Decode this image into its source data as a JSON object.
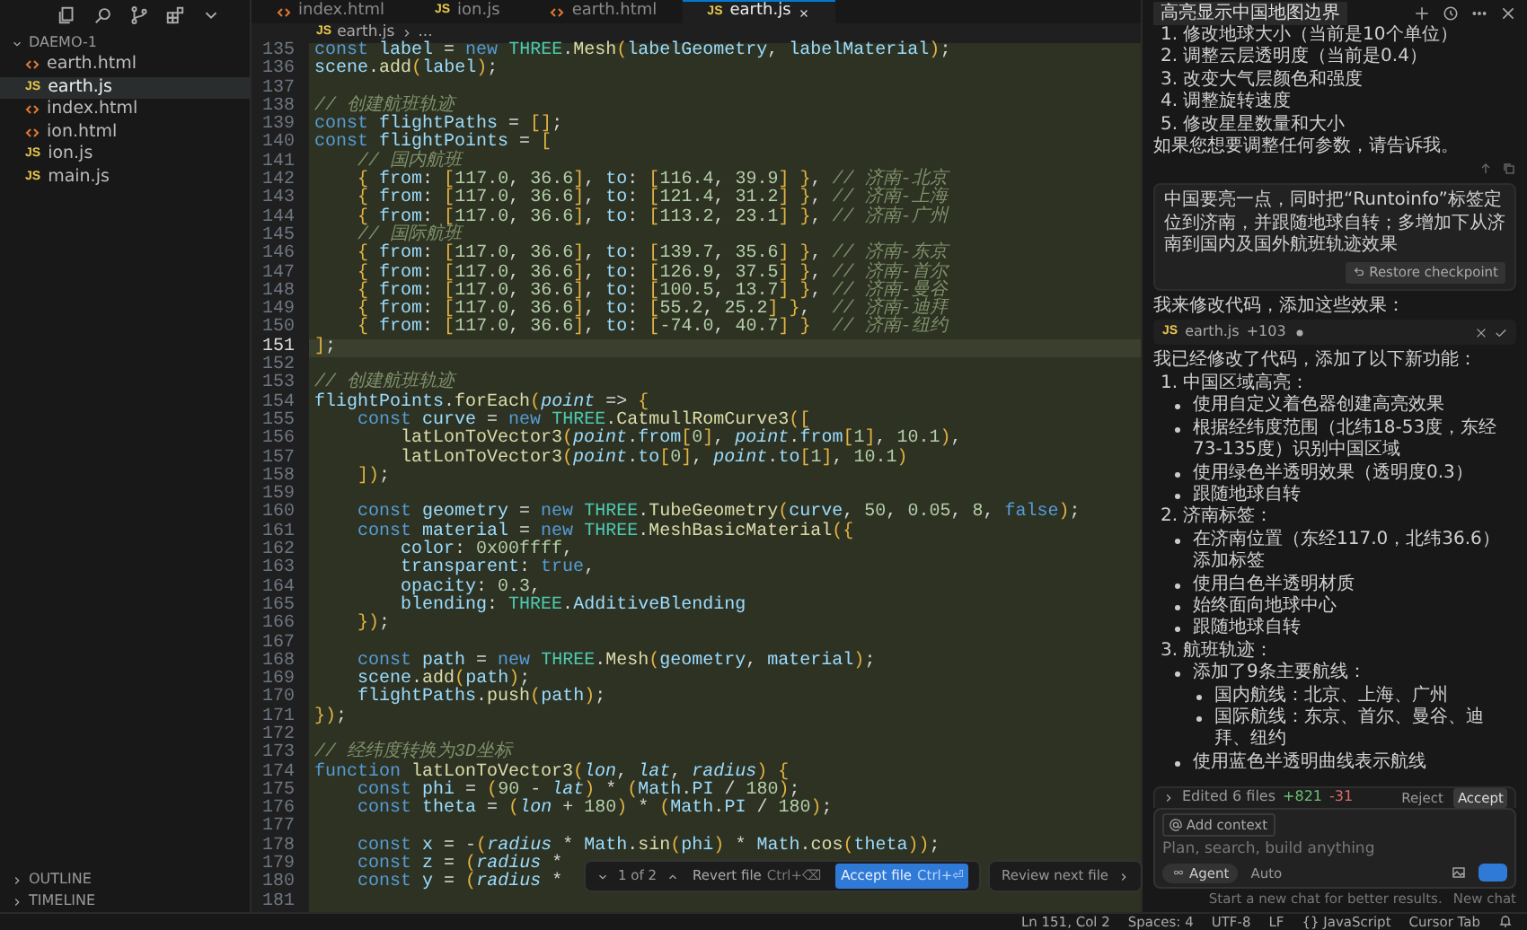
{
  "activity_icons": [
    {
      "kind": "files"
    },
    {
      "kind": "search"
    },
    {
      "kind": "branch"
    },
    {
      "kind": "extensions"
    },
    {
      "kind": "chevron"
    }
  ],
  "explorer": {
    "title": "DAEMO-1",
    "files": [
      {
        "name": "earth.html",
        "kind": "html",
        "selected": false
      },
      {
        "name": "earth.js",
        "kind": "js",
        "badge": "JS",
        "selected": true
      },
      {
        "name": "index.html",
        "kind": "html",
        "selected": false
      },
      {
        "name": "ion.html",
        "kind": "html",
        "selected": false
      },
      {
        "name": "ion.js",
        "kind": "js",
        "badge": "JS",
        "selected": false
      },
      {
        "name": "main.js",
        "kind": "js",
        "badge": "JS",
        "selected": false
      }
    ],
    "sections": [
      "OUTLINE",
      "TIMELINE"
    ]
  },
  "tabs": [
    {
      "label": "index.html",
      "kind": "html",
      "selected": false
    },
    {
      "label": "ion.js",
      "kind": "js",
      "badge": "JS",
      "selected": false
    },
    {
      "label": "earth.html",
      "kind": "html",
      "selected": false
    },
    {
      "label": "earth.js",
      "kind": "js",
      "badge": "JS",
      "selected": true
    }
  ],
  "breadcrumb": {
    "badge": "JS",
    "file": "earth.js",
    "rest": "..."
  },
  "code": [
    {
      "number": "135",
      "current": false,
      "tokens": [
        {
          "kind": "kw",
          "text": "const "
        },
        {
          "kind": "prop",
          "text": "label"
        },
        {
          "kind": "punc",
          "text": " = "
        },
        {
          "kind": "kw",
          "text": "new "
        },
        {
          "kind": "cls",
          "text": "THREE"
        },
        {
          "kind": "punc",
          "text": "."
        },
        {
          "kind": "fn",
          "text": "Mesh"
        },
        {
          "kind": "brk",
          "text": "("
        },
        {
          "kind": "prop",
          "text": "labelGeometry"
        },
        {
          "kind": "punc",
          "text": ", "
        },
        {
          "kind": "prop",
          "text": "labelMaterial"
        },
        {
          "kind": "brk",
          "text": ")"
        },
        {
          "kind": "punc",
          "text": ";"
        }
      ]
    },
    {
      "number": "136",
      "current": false,
      "tokens": [
        {
          "kind": "prop",
          "text": "scene"
        },
        {
          "kind": "punc",
          "text": "."
        },
        {
          "kind": "fn",
          "text": "add"
        },
        {
          "kind": "brk",
          "text": "("
        },
        {
          "kind": "prop",
          "text": "label"
        },
        {
          "kind": "brk",
          "text": ")"
        },
        {
          "kind": "punc",
          "text": ";"
        }
      ]
    },
    {
      "number": "137",
      "current": false
    },
    {
      "number": "138",
      "current": false,
      "tokens": [
        {
          "kind": "cmt",
          "text": "// 创建航班轨迹"
        }
      ]
    },
    {
      "number": "139",
      "current": false,
      "tokens": [
        {
          "kind": "kw",
          "text": "const "
        },
        {
          "kind": "prop",
          "text": "flightPaths"
        },
        {
          "kind": "punc",
          "text": " = "
        },
        {
          "kind": "brk",
          "text": "[]"
        },
        {
          "kind": "punc",
          "text": ";"
        }
      ]
    },
    {
      "number": "140",
      "current": false,
      "tokens": [
        {
          "kind": "kw",
          "text": "const "
        },
        {
          "kind": "prop",
          "text": "flightPoints"
        },
        {
          "kind": "punc",
          "text": " = "
        },
        {
          "kind": "brk",
          "text": "["
        }
      ]
    },
    {
      "number": "141",
      "current": false,
      "tokens": [
        {
          "kind": "cmt",
          "text": "    // 国内航班"
        }
      ]
    },
    {
      "number": "142",
      "current": false,
      "tokens": [
        {
          "kind": "brk",
          "text": "    { "
        },
        {
          "kind": "prop",
          "text": "from"
        },
        {
          "kind": "punc",
          "text": ": "
        },
        {
          "kind": "brk",
          "text": "["
        },
        {
          "kind": "num",
          "text": "117.0"
        },
        {
          "kind": "punc",
          "text": ", "
        },
        {
          "kind": "num",
          "text": "36.6"
        },
        {
          "kind": "brk",
          "text": "]"
        },
        {
          "kind": "punc",
          "text": ", "
        },
        {
          "kind": "prop",
          "text": "to"
        },
        {
          "kind": "punc",
          "text": ": "
        },
        {
          "kind": "brk",
          "text": "["
        },
        {
          "kind": "num",
          "text": "116.4"
        },
        {
          "kind": "punc",
          "text": ", "
        },
        {
          "kind": "num",
          "text": "39.9"
        },
        {
          "kind": "brk",
          "text": "] }"
        },
        {
          "kind": "punc",
          "text": ", "
        },
        {
          "kind": "cmt",
          "text": "// 济南-北京"
        }
      ]
    },
    {
      "number": "143",
      "current": false,
      "tokens": [
        {
          "kind": "brk",
          "text": "    { "
        },
        {
          "kind": "prop",
          "text": "from"
        },
        {
          "kind": "punc",
          "text": ": "
        },
        {
          "kind": "brk",
          "text": "["
        },
        {
          "kind": "num",
          "text": "117.0"
        },
        {
          "kind": "punc",
          "text": ", "
        },
        {
          "kind": "num",
          "text": "36.6"
        },
        {
          "kind": "brk",
          "text": "]"
        },
        {
          "kind": "punc",
          "text": ", "
        },
        {
          "kind": "prop",
          "text": "to"
        },
        {
          "kind": "punc",
          "text": ": "
        },
        {
          "kind": "brk",
          "text": "["
        },
        {
          "kind": "num",
          "text": "121.4"
        },
        {
          "kind": "punc",
          "text": ", "
        },
        {
          "kind": "num",
          "text": "31.2"
        },
        {
          "kind": "brk",
          "text": "] }"
        },
        {
          "kind": "punc",
          "text": ", "
        },
        {
          "kind": "cmt",
          "text": "// 济南-上海"
        }
      ]
    },
    {
      "number": "144",
      "current": false,
      "tokens": [
        {
          "kind": "brk",
          "text": "    { "
        },
        {
          "kind": "prop",
          "text": "from"
        },
        {
          "kind": "punc",
          "text": ": "
        },
        {
          "kind": "brk",
          "text": "["
        },
        {
          "kind": "num",
          "text": "117.0"
        },
        {
          "kind": "punc",
          "text": ", "
        },
        {
          "kind": "num",
          "text": "36.6"
        },
        {
          "kind": "brk",
          "text": "]"
        },
        {
          "kind": "punc",
          "text": ", "
        },
        {
          "kind": "prop",
          "text": "to"
        },
        {
          "kind": "punc",
          "text": ": "
        },
        {
          "kind": "brk",
          "text": "["
        },
        {
          "kind": "num",
          "text": "113.2"
        },
        {
          "kind": "punc",
          "text": ", "
        },
        {
          "kind": "num",
          "text": "23.1"
        },
        {
          "kind": "brk",
          "text": "] }"
        },
        {
          "kind": "punc",
          "text": ", "
        },
        {
          "kind": "cmt",
          "text": "// 济南-广州"
        }
      ]
    },
    {
      "number": "145",
      "current": false,
      "tokens": [
        {
          "kind": "cmt",
          "text": "    // 国际航班"
        }
      ]
    },
    {
      "number": "146",
      "current": false,
      "tokens": [
        {
          "kind": "brk",
          "text": "    { "
        },
        {
          "kind": "prop",
          "text": "from"
        },
        {
          "kind": "punc",
          "text": ": "
        },
        {
          "kind": "brk",
          "text": "["
        },
        {
          "kind": "num",
          "text": "117.0"
        },
        {
          "kind": "punc",
          "text": ", "
        },
        {
          "kind": "num",
          "text": "36.6"
        },
        {
          "kind": "brk",
          "text": "]"
        },
        {
          "kind": "punc",
          "text": ", "
        },
        {
          "kind": "prop",
          "text": "to"
        },
        {
          "kind": "punc",
          "text": ": "
        },
        {
          "kind": "brk",
          "text": "["
        },
        {
          "kind": "num",
          "text": "139.7"
        },
        {
          "kind": "punc",
          "text": ", "
        },
        {
          "kind": "num",
          "text": "35.6"
        },
        {
          "kind": "brk",
          "text": "] }"
        },
        {
          "kind": "punc",
          "text": ", "
        },
        {
          "kind": "cmt",
          "text": "// 济南-东京"
        }
      ]
    },
    {
      "number": "147",
      "current": false,
      "tokens": [
        {
          "kind": "brk",
          "text": "    { "
        },
        {
          "kind": "prop",
          "text": "from"
        },
        {
          "kind": "punc",
          "text": ": "
        },
        {
          "kind": "brk",
          "text": "["
        },
        {
          "kind": "num",
          "text": "117.0"
        },
        {
          "kind": "punc",
          "text": ", "
        },
        {
          "kind": "num",
          "text": "36.6"
        },
        {
          "kind": "brk",
          "text": "]"
        },
        {
          "kind": "punc",
          "text": ", "
        },
        {
          "kind": "prop",
          "text": "to"
        },
        {
          "kind": "punc",
          "text": ": "
        },
        {
          "kind": "brk",
          "text": "["
        },
        {
          "kind": "num",
          "text": "126.9"
        },
        {
          "kind": "punc",
          "text": ", "
        },
        {
          "kind": "num",
          "text": "37.5"
        },
        {
          "kind": "brk",
          "text": "] }"
        },
        {
          "kind": "punc",
          "text": ", "
        },
        {
          "kind": "cmt",
          "text": "// 济南-首尔"
        }
      ]
    },
    {
      "number": "148",
      "current": false,
      "tokens": [
        {
          "kind": "brk",
          "text": "    { "
        },
        {
          "kind": "prop",
          "text": "from"
        },
        {
          "kind": "punc",
          "text": ": "
        },
        {
          "kind": "brk",
          "text": "["
        },
        {
          "kind": "num",
          "text": "117.0"
        },
        {
          "kind": "punc",
          "text": ", "
        },
        {
          "kind": "num",
          "text": "36.6"
        },
        {
          "kind": "brk",
          "text": "]"
        },
        {
          "kind": "punc",
          "text": ", "
        },
        {
          "kind": "prop",
          "text": "to"
        },
        {
          "kind": "punc",
          "text": ": "
        },
        {
          "kind": "brk",
          "text": "["
        },
        {
          "kind": "num",
          "text": "100.5"
        },
        {
          "kind": "punc",
          "text": ", "
        },
        {
          "kind": "num",
          "text": "13.7"
        },
        {
          "kind": "brk",
          "text": "] }"
        },
        {
          "kind": "punc",
          "text": ", "
        },
        {
          "kind": "cmt",
          "text": "// 济南-曼谷"
        }
      ]
    },
    {
      "number": "149",
      "current": false,
      "tokens": [
        {
          "kind": "brk",
          "text": "    { "
        },
        {
          "kind": "prop",
          "text": "from"
        },
        {
          "kind": "punc",
          "text": ": "
        },
        {
          "kind": "brk",
          "text": "["
        },
        {
          "kind": "num",
          "text": "117.0"
        },
        {
          "kind": "punc",
          "text": ", "
        },
        {
          "kind": "num",
          "text": "36.6"
        },
        {
          "kind": "brk",
          "text": "]"
        },
        {
          "kind": "punc",
          "text": ", "
        },
        {
          "kind": "prop",
          "text": "to"
        },
        {
          "kind": "punc",
          "text": ": "
        },
        {
          "kind": "brk",
          "text": "["
        },
        {
          "kind": "num",
          "text": "55.2"
        },
        {
          "kind": "punc",
          "text": ", "
        },
        {
          "kind": "num",
          "text": "25.2"
        },
        {
          "kind": "brk",
          "text": "] }"
        },
        {
          "kind": "punc",
          "text": ",  "
        },
        {
          "kind": "cmt",
          "text": "// 济南-迪拜"
        }
      ]
    },
    {
      "number": "150",
      "current": false,
      "tokens": [
        {
          "kind": "brk",
          "text": "    { "
        },
        {
          "kind": "prop",
          "text": "from"
        },
        {
          "kind": "punc",
          "text": ": "
        },
        {
          "kind": "brk",
          "text": "["
        },
        {
          "kind": "num",
          "text": "117.0"
        },
        {
          "kind": "punc",
          "text": ", "
        },
        {
          "kind": "num",
          "text": "36.6"
        },
        {
          "kind": "brk",
          "text": "]"
        },
        {
          "kind": "punc",
          "text": ", "
        },
        {
          "kind": "prop",
          "text": "to"
        },
        {
          "kind": "punc",
          "text": ": "
        },
        {
          "kind": "brk",
          "text": "["
        },
        {
          "kind": "num",
          "text": "-74.0"
        },
        {
          "kind": "punc",
          "text": ", "
        },
        {
          "kind": "num",
          "text": "40.7"
        },
        {
          "kind": "brk",
          "text": "] }"
        },
        {
          "kind": "cmt",
          "text": "  // 济南-纽约"
        }
      ]
    },
    {
      "number": "151",
      "current": true,
      "tokens": [
        {
          "kind": "brk",
          "text": "]"
        },
        {
          "kind": "punc",
          "text": ";"
        }
      ]
    },
    {
      "number": "152",
      "current": false
    },
    {
      "number": "153",
      "current": false,
      "tokens": [
        {
          "kind": "cmt",
          "text": "// 创建航班轨迹"
        }
      ]
    },
    {
      "number": "154",
      "current": false,
      "tokens": [
        {
          "kind": "prop",
          "text": "flightPoints"
        },
        {
          "kind": "punc",
          "text": "."
        },
        {
          "kind": "fn",
          "text": "forEach"
        },
        {
          "kind": "brk",
          "text": "("
        },
        {
          "kind": "param",
          "text": "point"
        },
        {
          "kind": "punc",
          "text": " => "
        },
        {
          "kind": "brk",
          "text": "{"
        }
      ]
    },
    {
      "number": "155",
      "current": false,
      "tokens": [
        {
          "kind": "kw",
          "text": "    const "
        },
        {
          "kind": "prop",
          "text": "curve"
        },
        {
          "kind": "punc",
          "text": " = "
        },
        {
          "kind": "kw",
          "text": "new "
        },
        {
          "kind": "cls",
          "text": "THREE"
        },
        {
          "kind": "punc",
          "text": "."
        },
        {
          "kind": "fn",
          "text": "CatmullRomCurve3"
        },
        {
          "kind": "brk",
          "text": "(["
        }
      ]
    },
    {
      "number": "156",
      "current": false,
      "tokens": [
        {
          "kind": "fn",
          "text": "        latLonToVector3"
        },
        {
          "kind": "brk",
          "text": "("
        },
        {
          "kind": "param",
          "text": "point"
        },
        {
          "kind": "punc",
          "text": "."
        },
        {
          "kind": "prop",
          "text": "from"
        },
        {
          "kind": "brk",
          "text": "["
        },
        {
          "kind": "num",
          "text": "0"
        },
        {
          "kind": "brk",
          "text": "]"
        },
        {
          "kind": "punc",
          "text": ", "
        },
        {
          "kind": "param",
          "text": "point"
        },
        {
          "kind": "punc",
          "text": "."
        },
        {
          "kind": "prop",
          "text": "from"
        },
        {
          "kind": "brk",
          "text": "["
        },
        {
          "kind": "num",
          "text": "1"
        },
        {
          "kind": "brk",
          "text": "]"
        },
        {
          "kind": "punc",
          "text": ", "
        },
        {
          "kind": "num",
          "text": "10.1"
        },
        {
          "kind": "brk",
          "text": ")"
        },
        {
          "kind": "punc",
          "text": ","
        }
      ]
    },
    {
      "number": "157",
      "current": false,
      "tokens": [
        {
          "kind": "fn",
          "text": "        latLonToVector3"
        },
        {
          "kind": "brk",
          "text": "("
        },
        {
          "kind": "param",
          "text": "point"
        },
        {
          "kind": "punc",
          "text": "."
        },
        {
          "kind": "prop",
          "text": "to"
        },
        {
          "kind": "brk",
          "text": "["
        },
        {
          "kind": "num",
          "text": "0"
        },
        {
          "kind": "brk",
          "text": "]"
        },
        {
          "kind": "punc",
          "text": ", "
        },
        {
          "kind": "param",
          "text": "point"
        },
        {
          "kind": "punc",
          "text": "."
        },
        {
          "kind": "prop",
          "text": "to"
        },
        {
          "kind": "brk",
          "text": "["
        },
        {
          "kind": "num",
          "text": "1"
        },
        {
          "kind": "brk",
          "text": "]"
        },
        {
          "kind": "punc",
          "text": ", "
        },
        {
          "kind": "num",
          "text": "10.1"
        },
        {
          "kind": "brk",
          "text": ")"
        }
      ]
    },
    {
      "number": "158",
      "current": false,
      "tokens": [
        {
          "kind": "brk",
          "text": "    ])"
        },
        {
          "kind": "punc",
          "text": ";"
        }
      ]
    },
    {
      "number": "159",
      "current": false
    },
    {
      "number": "160",
      "current": false,
      "tokens": [
        {
          "kind": "kw",
          "text": "    const "
        },
        {
          "kind": "prop",
          "text": "geometry"
        },
        {
          "kind": "punc",
          "text": " = "
        },
        {
          "kind": "kw",
          "text": "new "
        },
        {
          "kind": "cls",
          "text": "THREE"
        },
        {
          "kind": "punc",
          "text": "."
        },
        {
          "kind": "fn",
          "text": "TubeGeometry"
        },
        {
          "kind": "brk",
          "text": "("
        },
        {
          "kind": "prop",
          "text": "curve"
        },
        {
          "kind": "punc",
          "text": ", "
        },
        {
          "kind": "num",
          "text": "50"
        },
        {
          "kind": "punc",
          "text": ", "
        },
        {
          "kind": "num",
          "text": "0.05"
        },
        {
          "kind": "punc",
          "text": ", "
        },
        {
          "kind": "num",
          "text": "8"
        },
        {
          "kind": "punc",
          "text": ", "
        },
        {
          "kind": "kw",
          "text": "false"
        },
        {
          "kind": "brk",
          "text": ")"
        },
        {
          "kind": "punc",
          "text": ";"
        }
      ]
    },
    {
      "number": "161",
      "current": false,
      "tokens": [
        {
          "kind": "kw",
          "text": "    const "
        },
        {
          "kind": "prop",
          "text": "material"
        },
        {
          "kind": "punc",
          "text": " = "
        },
        {
          "kind": "kw",
          "text": "new "
        },
        {
          "kind": "cls",
          "text": "THREE"
        },
        {
          "kind": "punc",
          "text": "."
        },
        {
          "kind": "fn",
          "text": "MeshBasicMaterial"
        },
        {
          "kind": "brk",
          "text": "({"
        }
      ]
    },
    {
      "number": "162",
      "current": false,
      "tokens": [
        {
          "kind": "prop",
          "text": "        color"
        },
        {
          "kind": "punc",
          "text": ": "
        },
        {
          "kind": "num",
          "text": "0x00ffff"
        },
        {
          "kind": "punc",
          "text": ","
        }
      ]
    },
    {
      "number": "163",
      "current": false,
      "tokens": [
        {
          "kind": "prop",
          "text": "        transparent"
        },
        {
          "kind": "punc",
          "text": ": "
        },
        {
          "kind": "kw",
          "text": "true"
        },
        {
          "kind": "punc",
          "text": ","
        }
      ]
    },
    {
      "number": "164",
      "current": false,
      "tokens": [
        {
          "kind": "prop",
          "text": "        opacity"
        },
        {
          "kind": "punc",
          "text": ": "
        },
        {
          "kind": "num",
          "text": "0.3"
        },
        {
          "kind": "punc",
          "text": ","
        }
      ]
    },
    {
      "number": "165",
      "current": false,
      "tokens": [
        {
          "kind": "prop",
          "text": "        blending"
        },
        {
          "kind": "punc",
          "text": ": "
        },
        {
          "kind": "cls",
          "text": "THREE"
        },
        {
          "kind": "punc",
          "text": "."
        },
        {
          "kind": "prop",
          "text": "AdditiveBlending"
        }
      ]
    },
    {
      "number": "166",
      "current": false,
      "tokens": [
        {
          "kind": "brk",
          "text": "    })"
        },
        {
          "kind": "punc",
          "text": ";"
        }
      ]
    },
    {
      "number": "167",
      "current": false
    },
    {
      "number": "168",
      "current": false,
      "tokens": [
        {
          "kind": "kw",
          "text": "    const "
        },
        {
          "kind": "prop",
          "text": "path"
        },
        {
          "kind": "punc",
          "text": " = "
        },
        {
          "kind": "kw",
          "text": "new "
        },
        {
          "kind": "cls",
          "text": "THREE"
        },
        {
          "kind": "punc",
          "text": "."
        },
        {
          "kind": "fn",
          "text": "Mesh"
        },
        {
          "kind": "brk",
          "text": "("
        },
        {
          "kind": "prop",
          "text": "geometry"
        },
        {
          "kind": "punc",
          "text": ", "
        },
        {
          "kind": "prop",
          "text": "material"
        },
        {
          "kind": "brk",
          "text": ")"
        },
        {
          "kind": "punc",
          "text": ";"
        }
      ]
    },
    {
      "number": "169",
      "current": false,
      "tokens": [
        {
          "kind": "prop",
          "text": "    scene"
        },
        {
          "kind": "punc",
          "text": "."
        },
        {
          "kind": "fn",
          "text": "add"
        },
        {
          "kind": "brk",
          "text": "("
        },
        {
          "kind": "prop",
          "text": "path"
        },
        {
          "kind": "brk",
          "text": ")"
        },
        {
          "kind": "punc",
          "text": ";"
        }
      ]
    },
    {
      "number": "170",
      "current": false,
      "tokens": [
        {
          "kind": "prop",
          "text": "    flightPaths"
        },
        {
          "kind": "punc",
          "text": "."
        },
        {
          "kind": "fn",
          "text": "push"
        },
        {
          "kind": "brk",
          "text": "("
        },
        {
          "kind": "prop",
          "text": "path"
        },
        {
          "kind": "brk",
          "text": ")"
        },
        {
          "kind": "punc",
          "text": ";"
        }
      ]
    },
    {
      "number": "171",
      "current": false,
      "tokens": [
        {
          "kind": "brk",
          "text": "})"
        },
        {
          "kind": "punc",
          "text": ";"
        }
      ]
    },
    {
      "number": "172",
      "current": false
    },
    {
      "number": "173",
      "current": false,
      "tokens": [
        {
          "kind": "cmt",
          "text": "// 经纬度转换为3D坐标"
        }
      ]
    },
    {
      "number": "174",
      "current": false,
      "tokens": [
        {
          "kind": "kw",
          "text": "function "
        },
        {
          "kind": "fn",
          "text": "latLonToVector3"
        },
        {
          "kind": "brk",
          "text": "("
        },
        {
          "kind": "param",
          "text": "lon"
        },
        {
          "kind": "punc",
          "text": ", "
        },
        {
          "kind": "param",
          "text": "lat"
        },
        {
          "kind": "punc",
          "text": ", "
        },
        {
          "kind": "param",
          "text": "radius"
        },
        {
          "kind": "brk",
          "text": ") {"
        }
      ]
    },
    {
      "number": "175",
      "current": false,
      "tokens": [
        {
          "kind": "kw",
          "text": "    const "
        },
        {
          "kind": "prop",
          "text": "phi"
        },
        {
          "kind": "punc",
          "text": " = "
        },
        {
          "kind": "brk",
          "text": "("
        },
        {
          "kind": "num",
          "text": "90"
        },
        {
          "kind": "punc",
          "text": " - "
        },
        {
          "kind": "param",
          "text": "lat"
        },
        {
          "kind": "brk",
          "text": ")"
        },
        {
          "kind": "punc",
          "text": " * "
        },
        {
          "kind": "brk",
          "text": "("
        },
        {
          "kind": "prop",
          "text": "Math"
        },
        {
          "kind": "punc",
          "text": "."
        },
        {
          "kind": "prop",
          "text": "PI"
        },
        {
          "kind": "punc",
          "text": " / "
        },
        {
          "kind": "num",
          "text": "180"
        },
        {
          "kind": "brk",
          "text": ")"
        },
        {
          "kind": "punc",
          "text": ";"
        }
      ]
    },
    {
      "number": "176",
      "current": false,
      "tokens": [
        {
          "kind": "kw",
          "text": "    const "
        },
        {
          "kind": "prop",
          "text": "theta"
        },
        {
          "kind": "punc",
          "text": " = "
        },
        {
          "kind": "brk",
          "text": "("
        },
        {
          "kind": "param",
          "text": "lon"
        },
        {
          "kind": "punc",
          "text": " + "
        },
        {
          "kind": "num",
          "text": "180"
        },
        {
          "kind": "brk",
          "text": ")"
        },
        {
          "kind": "punc",
          "text": " * "
        },
        {
          "kind": "brk",
          "text": "("
        },
        {
          "kind": "prop",
          "text": "Math"
        },
        {
          "kind": "punc",
          "text": "."
        },
        {
          "kind": "prop",
          "text": "PI"
        },
        {
          "kind": "punc",
          "text": " / "
        },
        {
          "kind": "num",
          "text": "180"
        },
        {
          "kind": "brk",
          "text": ")"
        },
        {
          "kind": "punc",
          "text": ";"
        }
      ]
    },
    {
      "number": "177",
      "current": false
    },
    {
      "number": "178",
      "current": false,
      "tokens": [
        {
          "kind": "kw",
          "text": "    const "
        },
        {
          "kind": "prop",
          "text": "x"
        },
        {
          "kind": "punc",
          "text": " = -"
        },
        {
          "kind": "brk",
          "text": "("
        },
        {
          "kind": "param",
          "text": "radius"
        },
        {
          "kind": "punc",
          "text": " * "
        },
        {
          "kind": "prop",
          "text": "Math"
        },
        {
          "kind": "punc",
          "text": "."
        },
        {
          "kind": "fn",
          "text": "sin"
        },
        {
          "kind": "brk",
          "text": "("
        },
        {
          "kind": "prop",
          "text": "phi"
        },
        {
          "kind": "brk",
          "text": ")"
        },
        {
          "kind": "punc",
          "text": " * "
        },
        {
          "kind": "prop",
          "text": "Math"
        },
        {
          "kind": "punc",
          "text": "."
        },
        {
          "kind": "fn",
          "text": "cos"
        },
        {
          "kind": "brk",
          "text": "("
        },
        {
          "kind": "prop",
          "text": "theta"
        },
        {
          "kind": "brk",
          "text": "))"
        },
        {
          "kind": "punc",
          "text": ";"
        }
      ]
    },
    {
      "number": "179",
      "current": false,
      "tokens": [
        {
          "kind": "kw",
          "text": "    const "
        },
        {
          "kind": "prop",
          "text": "z"
        },
        {
          "kind": "punc",
          "text": " = "
        },
        {
          "kind": "brk",
          "text": "("
        },
        {
          "kind": "param",
          "text": "radius"
        },
        {
          "kind": "punc",
          "text": " *"
        }
      ]
    },
    {
      "number": "180",
      "current": false,
      "tokens": [
        {
          "kind": "kw",
          "text": "    const "
        },
        {
          "kind": "prop",
          "text": "y"
        },
        {
          "kind": "punc",
          "text": " = "
        },
        {
          "kind": "brk",
          "text": "("
        },
        {
          "kind": "param",
          "text": "radius"
        },
        {
          "kind": "punc",
          "text": " *"
        }
      ]
    },
    {
      "number": "181",
      "current": false
    }
  ],
  "review_bar": {
    "counter": "1 of 2",
    "revert": "Revert file",
    "revert_key": "Ctrl+⌫",
    "accept": "Accept file",
    "accept_key": "Ctrl+⏎",
    "next": "Review next file"
  },
  "chat": {
    "title": "高亮显示中国地图边界",
    "intro_list": [
      {
        "number": "1.",
        "text": "修改地球大小（当前是10个单位）"
      },
      {
        "number": "2.",
        "text": "调整云层透明度（当前是0.4）"
      },
      {
        "number": "3.",
        "text": "改变大气层颜色和强度"
      },
      {
        "number": "4.",
        "text": "调整旋转速度"
      },
      {
        "number": "5.",
        "text": "修改星星数量和大小"
      }
    ],
    "intro_note": "如果您想要调整任何参数，请告诉我。",
    "user_message": "中国要亮一点，同时把“Runtoinfo”标签定位到济南，并跟随地球自转；多增加下从济南到国内及国外航班轨迹效果",
    "restore_button": "Restore checkpoint",
    "reply_intro": "我来修改代码，添加这些效果：",
    "file_chip": {
      "badge": "JS",
      "name": "earth.js",
      "changes": "+103"
    },
    "reply_summary": "我已经修改了代码，添加了以下新功能：",
    "features": [
      {
        "number": "1.",
        "title": "中国区域高亮：",
        "items": [
          {
            "text": "使用自定义着色器创建高亮效果"
          },
          {
            "text": "根据经纬度范围（北纬18-53度，东经73-135度）识别中国区域"
          },
          {
            "text": "使用绿色半透明效果（透明度0.3）"
          },
          {
            "text": "跟随地球自转"
          }
        ]
      },
      {
        "number": "2.",
        "title": "济南标签：",
        "items": [
          {
            "text": "在济南位置（东经117.0，北纬36.6）添加标签"
          },
          {
            "text": "使用白色半透明材质"
          },
          {
            "text": "始终面向地球中心"
          },
          {
            "text": "跟随地球自转"
          }
        ]
      },
      {
        "number": "3.",
        "title": "航班轨迹：",
        "items": [
          {
            "text": "添加了9条主要航线：",
            "children": [
              {
                "text": "国内航线：北京、上海、广州"
              },
              {
                "text": "国际航线：东京、首尔、曼谷、迪拜、纽约"
              }
            ]
          },
          {
            "text": "使用蓝色半透明曲线表示航线"
          }
        ]
      }
    ],
    "composer": {
      "edited": "Edited 6 files",
      "added": "+821",
      "removed": "-31",
      "reject": "Reject",
      "accept": "Accept",
      "add_context": "Add context",
      "placeholder": "Plan, search, build anything",
      "mode": "Agent",
      "model": "Auto",
      "hint": "Start a new chat for better results.",
      "new_chat": "New chat"
    }
  },
  "status_bar": [
    "Ln 151, Col 2",
    "Spaces: 4",
    "UTF-8",
    "LF",
    "{} JavaScript",
    "Cursor Tab"
  ]
}
